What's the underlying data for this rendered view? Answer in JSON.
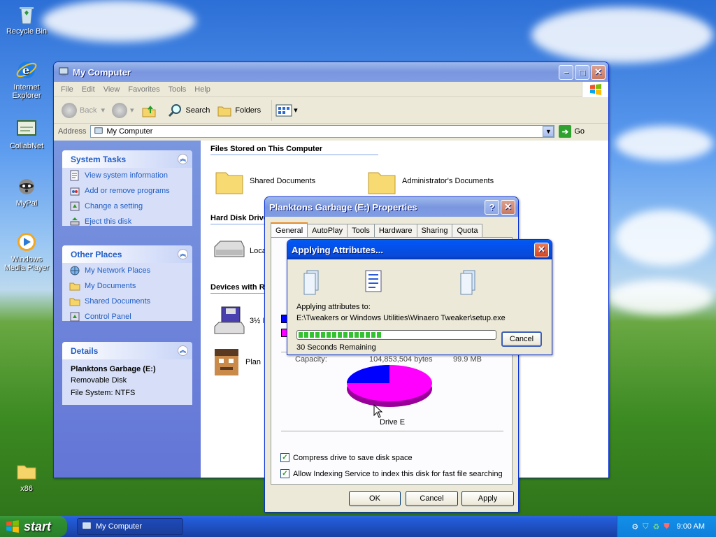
{
  "desktop": {
    "icons": [
      {
        "label": "Recycle Bin"
      },
      {
        "label": "Internet Explorer"
      },
      {
        "label": "CollabNet"
      },
      {
        "label": "MyPal"
      },
      {
        "label": "Windows Media Player"
      },
      {
        "label": "x86"
      }
    ]
  },
  "explorer": {
    "title": "My Computer",
    "menu": [
      "File",
      "Edit",
      "View",
      "Favorites",
      "Tools",
      "Help"
    ],
    "toolbar": {
      "back": "Back",
      "search": "Search",
      "folders": "Folders"
    },
    "address": {
      "label": "Address",
      "value": "My Computer",
      "go": "Go"
    },
    "system_tasks": {
      "title": "System Tasks",
      "items": [
        "View system information",
        "Add or remove programs",
        "Change a setting",
        "Eject this disk"
      ]
    },
    "other_places": {
      "title": "Other Places",
      "items": [
        "My Network Places",
        "My Documents",
        "Shared Documents",
        "Control Panel"
      ]
    },
    "details": {
      "title": "Details",
      "name": "Planktons Garbage (E:)",
      "type": "Removable Disk",
      "fs": "File System: NTFS"
    },
    "sections": {
      "files": "Files Stored on This Computer",
      "hdd": "Hard Disk Drives",
      "devices": "Devices with Removable Storage"
    },
    "items": {
      "shared_docs": "Shared Documents",
      "admin_docs": "Administrator's Documents",
      "local": "Local Disk (C:)",
      "floppy": "3½ Floppy (A:)",
      "plankton": "Planktons Garbage (E:)"
    }
  },
  "properties": {
    "title": "Planktons Garbage (E:) Properties",
    "tabs": [
      "General",
      "AutoPlay",
      "Tools",
      "Hardware",
      "Sharing",
      "Quota"
    ],
    "capacity_label": "Capacity:",
    "capacity_bytes": "104,853,504 bytes",
    "capacity_mb": "99.9 MB",
    "drive_label": "Drive E",
    "compress": "Compress drive to save disk space",
    "indexing": "Allow Indexing Service to index this disk for fast file searching",
    "ok": "OK",
    "cancel": "Cancel",
    "apply": "Apply",
    "colors": {
      "used": "#0000ff",
      "free": "#ff00ff"
    }
  },
  "applying": {
    "title": "Applying Attributes...",
    "label": "Applying attributes to:",
    "path": "E:\\Tweakers or Windows Utilities\\Winaero Tweaker\\setup.exe",
    "progress": 0.42,
    "remaining": "30 Seconds Remaining",
    "cancel": "Cancel"
  },
  "taskbar": {
    "start": "start",
    "task": "My Computer",
    "clock": "9:00 AM"
  }
}
